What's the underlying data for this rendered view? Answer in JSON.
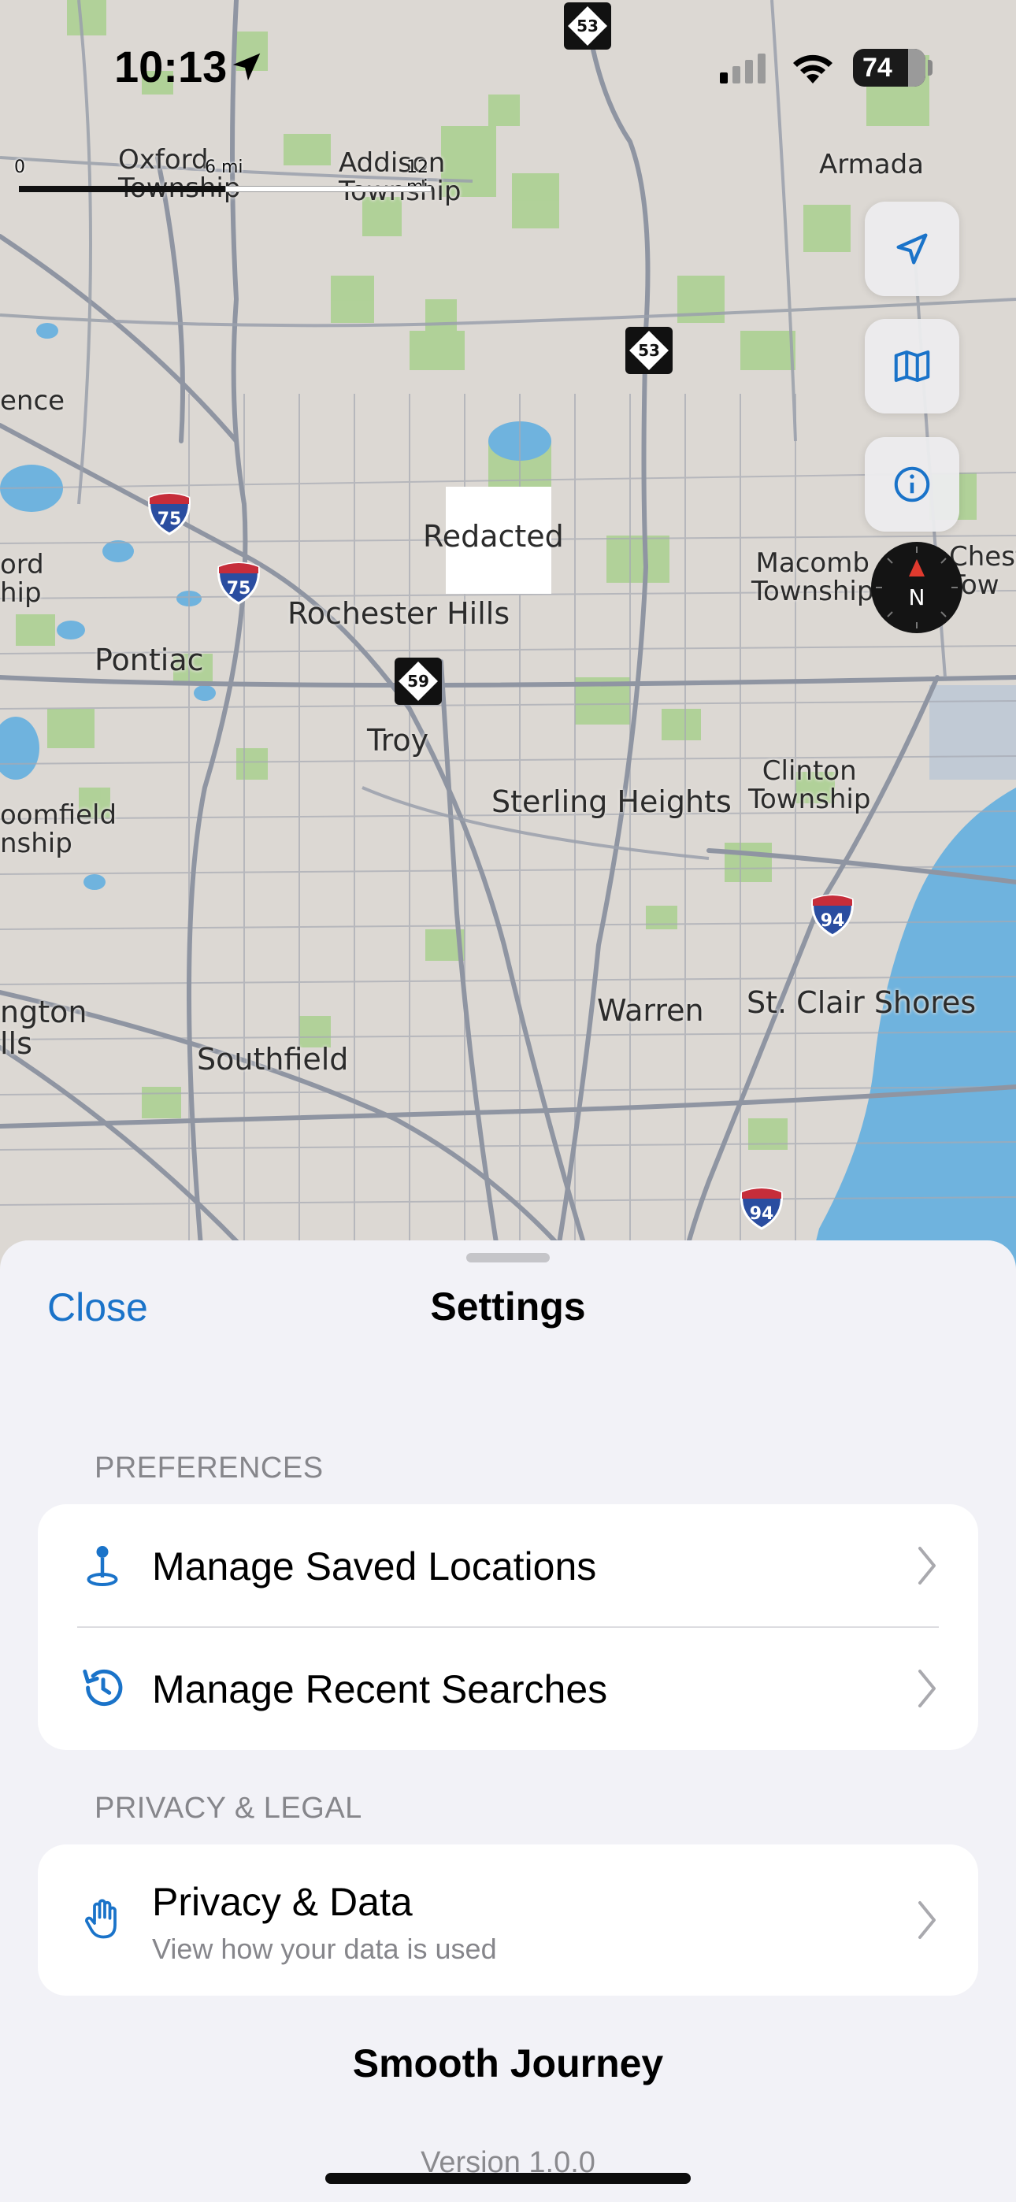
{
  "status_bar": {
    "time": "10:13",
    "battery": "74"
  },
  "map": {
    "scale": {
      "zero": "0",
      "mid": "6 mi",
      "end": "12 mi"
    },
    "redacted_label": "Redacted",
    "places": [
      {
        "name": "Oxford\nTownship",
        "id": "oxford-township"
      },
      {
        "name": "Addison\nTownship",
        "id": "addison-township"
      },
      {
        "name": "Armada",
        "id": "armada"
      },
      {
        "name": "ence",
        "id": "independence-fragment"
      },
      {
        "name": "ord\nhip",
        "id": "waterford-township-fragment"
      },
      {
        "name": "Rochester Hills",
        "id": "rochester-hills"
      },
      {
        "name": "Macomb\nTownship",
        "id": "macomb-township"
      },
      {
        "name": "Chest\nTow",
        "id": "chesterfield-township-fragment"
      },
      {
        "name": "Pontiac",
        "id": "pontiac"
      },
      {
        "name": "Troy",
        "id": "troy"
      },
      {
        "name": "Clinton\nTownship",
        "id": "clinton-township"
      },
      {
        "name": "Sterling Heights",
        "id": "sterling-heights"
      },
      {
        "name": "oomfield\nnship",
        "id": "bloomfield-township-fragment"
      },
      {
        "name": "ngton\nlls",
        "id": "farmington-hills-fragment"
      },
      {
        "name": "Warren",
        "id": "warren"
      },
      {
        "name": "St. Clair Shores",
        "id": "st-clair-shores"
      },
      {
        "name": "Southfield",
        "id": "southfield"
      }
    ],
    "shields": {
      "m53_top": "53",
      "m53_mid": "53",
      "m59": "59",
      "i75_a": "75",
      "i75_b": "75",
      "i94_a": "94",
      "i94_b": "94"
    },
    "compass_letter": "N",
    "controls": [
      "location-arrow-icon",
      "map-icon",
      "info-icon"
    ]
  },
  "sheet": {
    "close_label": "Close",
    "title": "Settings",
    "sections": [
      {
        "header": "PREFERENCES",
        "rows": [
          {
            "label": "Manage Saved Locations",
            "icon": "pin-icon"
          },
          {
            "label": "Manage Recent Searches",
            "icon": "history-icon"
          }
        ]
      },
      {
        "header": "PRIVACY & LEGAL",
        "rows": [
          {
            "label": "Privacy & Data",
            "sublabel": "View how your data is used",
            "icon": "hand-icon"
          }
        ]
      }
    ],
    "app_name": "Smooth Journey",
    "version": "Version 1.0.0"
  },
  "colors": {
    "accent": "#1a73c9",
    "sheet_bg": "#f2f2f7",
    "map_bg": "#dcd8d3",
    "park_green": "#a9d08e",
    "water_blue": "#6fb3de",
    "road_gray": "#9aa0ab"
  }
}
